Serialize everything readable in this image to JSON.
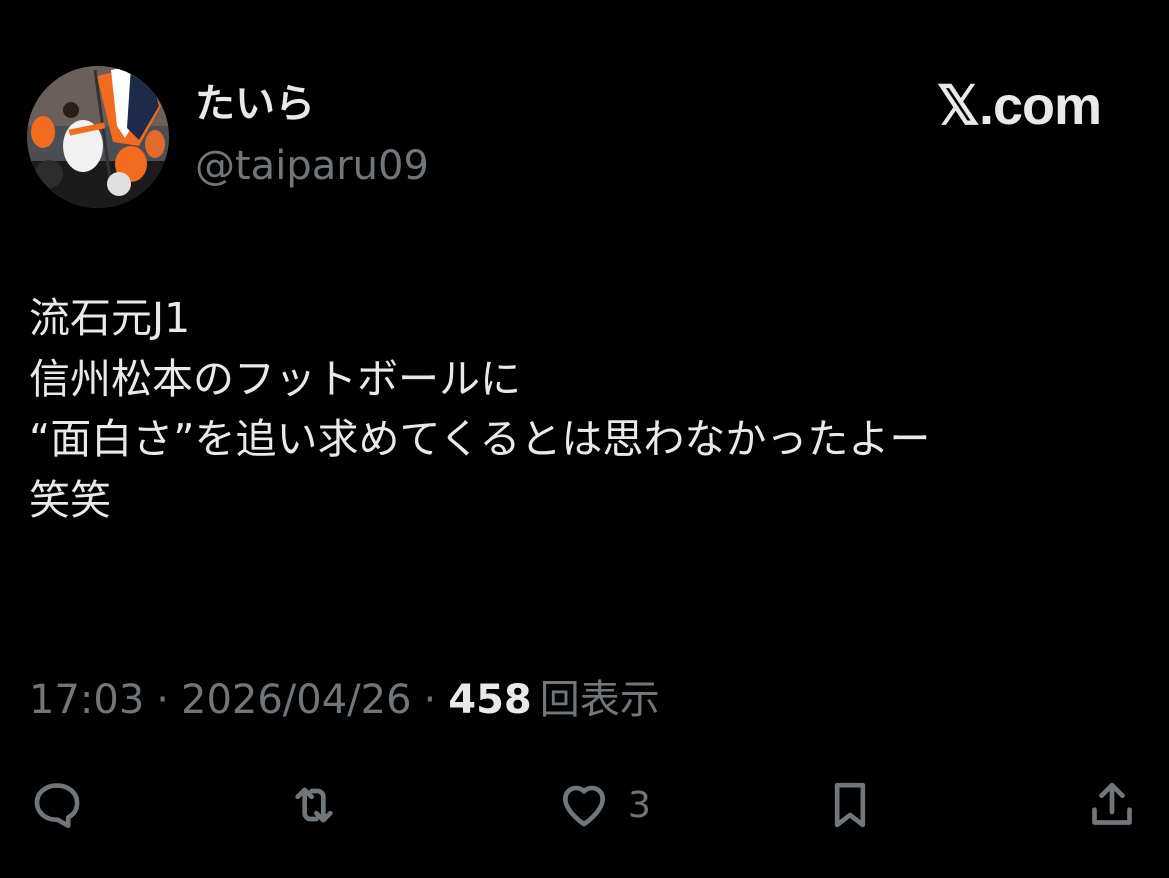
{
  "user": {
    "display_name": "たいら",
    "handle": "@taiparu09"
  },
  "brand": "𝕏.com",
  "tweet": {
    "lines": [
      "流石元J1",
      "信州松本のフットボールに",
      "“面白さ”を追い求めてくるとは思わなかったよー",
      "笑笑"
    ]
  },
  "meta": {
    "time": "17:03",
    "separator": "·",
    "date": "2026/04/26",
    "views_count": "458",
    "views_label": "回表示"
  },
  "actions": {
    "reply_icon": "reply-icon",
    "retweet_icon": "retweet-icon",
    "like_icon": "heart-icon",
    "like_count": "3",
    "bookmark_icon": "bookmark-icon",
    "share_icon": "share-icon"
  },
  "colors": {
    "background": "#000000",
    "primary_text": "#e7e9ea",
    "secondary_text": "#71767b",
    "avatar_accent": "#f26b1f"
  }
}
